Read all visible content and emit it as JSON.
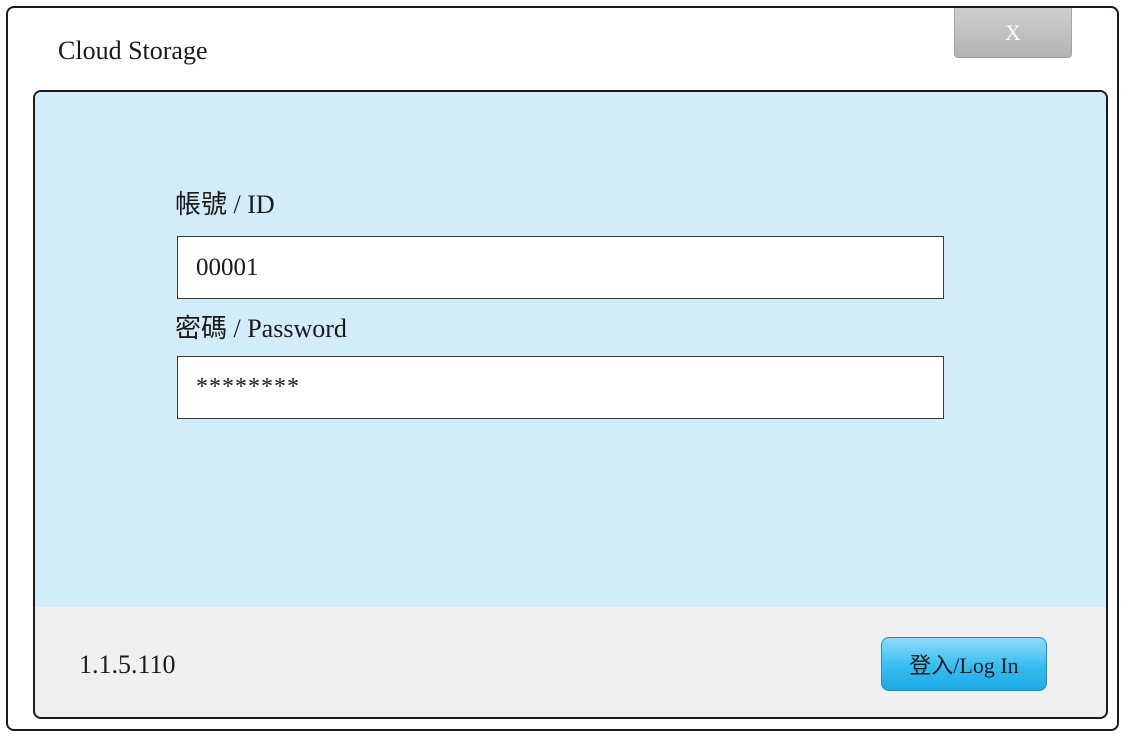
{
  "window": {
    "title": "Cloud Storage",
    "close_label": "X"
  },
  "form": {
    "id_label": "帳號 / ID",
    "id_value": "00001",
    "password_label": "密碼 / Password",
    "password_value": "********"
  },
  "footer": {
    "version": "1.1.5.110",
    "login_label": "登入/Log In"
  },
  "colors": {
    "form_background": "#d2ecf9",
    "footer_background": "#f0f0f0",
    "login_button": "#36bdf0",
    "close_button": "#c3c3c3"
  }
}
